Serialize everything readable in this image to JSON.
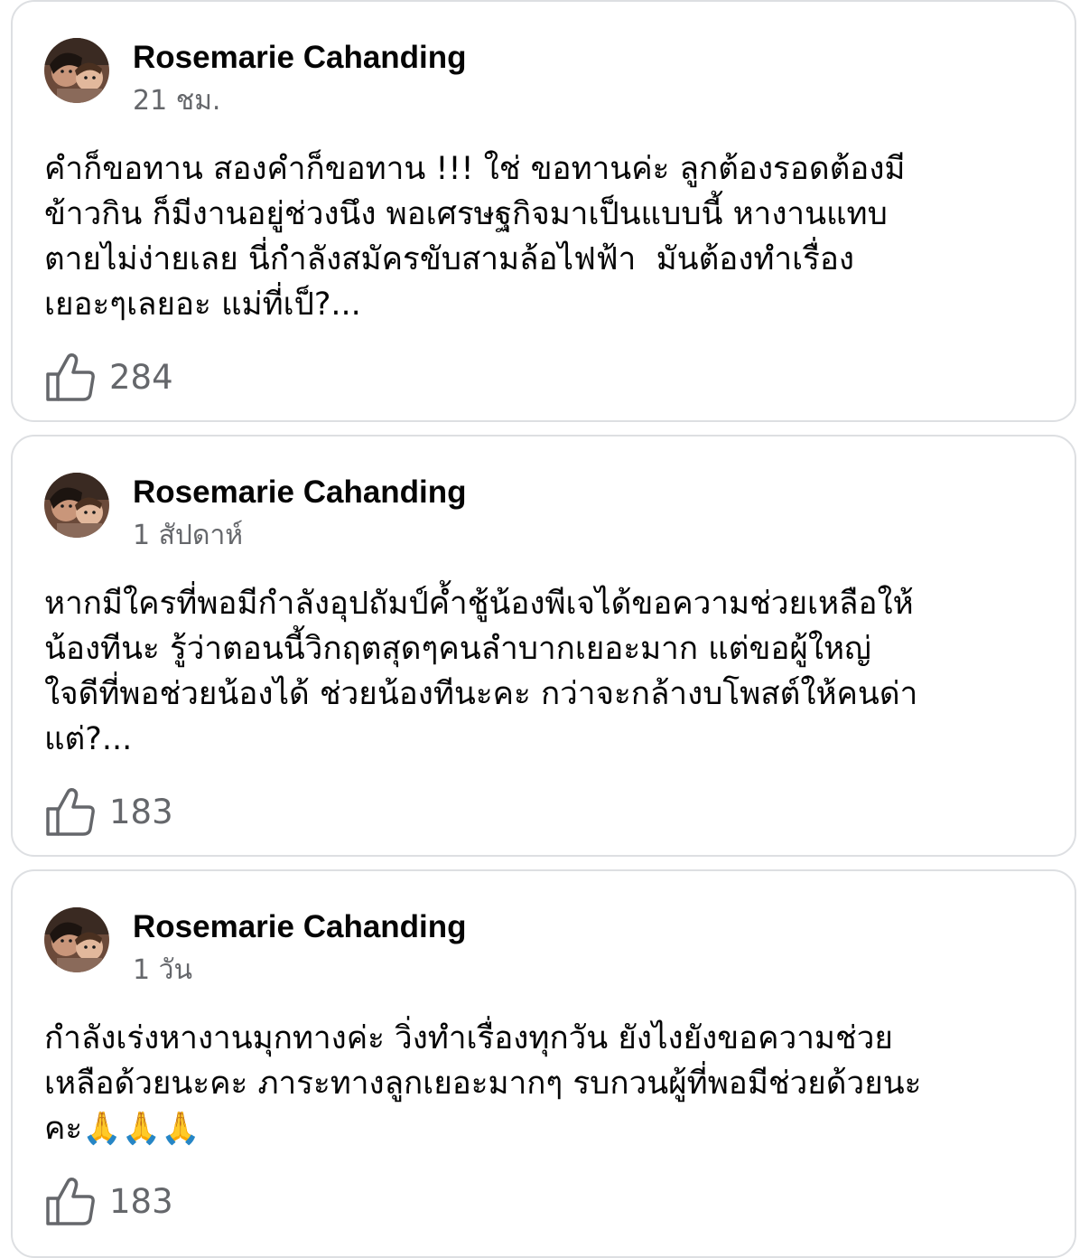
{
  "posts": [
    {
      "author": "Rosemarie Cahanding",
      "time": "21 ชม.",
      "text": "คำก็ขอทาน สองคำก็ขอทาน !!! ใช่ ขอทานค่ะ ลูกต้องรอดต้องมี\nข้าวกิน ก็มีงานอยู่ช่วงนึง พอเศรษฐกิจมาเป็นแบบนี้ หางานแทบ\nตายไม่ง่ายเลย นี่กำลังสมัครขับสามล้อไฟฟ้า  มันต้องทำเรื่อง\nเยอะๆเลยอะ แม่ที่เป็?...",
      "likes": "284",
      "like_icon": "thumbs-up-icon"
    },
    {
      "author": "Rosemarie Cahanding",
      "time": "1 สัปดาห์",
      "text": "หากมีใครที่พอมีกำลังอุปถัมป์ค้ำชู้น้องพีเจได้ขอความช่วยเหลือให้\nน้องทีนะ รู้ว่าตอนนี้วิกฤตสุดๆคนลำบากเยอะมาก แต่ขอผู้ใหญ่\nใจดีที่พอช่วยน้องได้ ช่วยน้องทีนะคะ กว่าจะกล้างบโพสต์ให้คนด่า\nแต่?...",
      "likes": "183",
      "like_icon": "thumbs-up-icon"
    },
    {
      "author": "Rosemarie Cahanding",
      "time": "1 วัน",
      "text": "กำลังเร่งหางานมุกทางค่ะ วิ่งทำเรื่องทุกวัน ยังไงยังขอความช่วย\nเหลือด้วยนะคะ ภาระทางลูกเยอะมากๆ รบกวนผู้ที่พอมีช่วยด้วยนะ\nคะ🙏🙏🙏",
      "likes": "183",
      "like_icon": "thumbs-up-icon"
    }
  ],
  "colors": {
    "card_border": "#dddfe2",
    "text": "#050505",
    "secondary_text": "#65676b"
  }
}
